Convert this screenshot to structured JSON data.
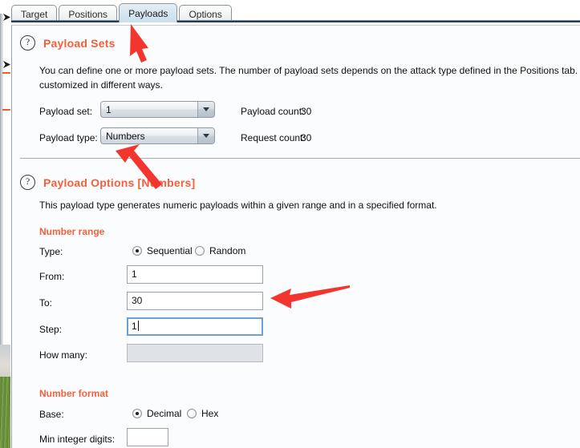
{
  "tabs": [
    {
      "label": "Target",
      "active": false
    },
    {
      "label": "Positions",
      "active": false
    },
    {
      "label": "Payloads",
      "active": true
    },
    {
      "label": "Options",
      "active": false
    }
  ],
  "payload_sets": {
    "help_icon": "question-mark-icon",
    "title": "Payload Sets",
    "description_line1": "You can define one or more payload sets. The number of payload sets depends on the attack type defined in the Positions tab. Various pay",
    "description_line2": "customized in different ways.",
    "payload_set_label": "Payload set:",
    "payload_set_value": "1",
    "payload_type_label": "Payload type:",
    "payload_type_value": "Numbers",
    "payload_count_label": "Payload count:",
    "payload_count_value": "30",
    "request_count_label": "Request count:",
    "request_count_value": "30"
  },
  "payload_options": {
    "help_icon": "question-mark-icon",
    "title": "Payload Options [Numbers]",
    "description": "This payload type generates numeric payloads within a given range and in a specified format.",
    "number_range": {
      "group_title": "Number range",
      "type_label": "Type:",
      "options": [
        {
          "label": "Sequential",
          "checked": true
        },
        {
          "label": "Random",
          "checked": false
        }
      ],
      "from_label": "From:",
      "from_value": "1",
      "to_label": "To:",
      "to_value": "30",
      "step_label": "Step:",
      "step_value": "1",
      "step_focused": true,
      "how_many_label": "How many:",
      "how_many_value": "",
      "how_many_disabled": true
    },
    "number_format": {
      "group_title": "Number format",
      "base_label": "Base:",
      "options": [
        {
          "label": "Decimal",
          "checked": true
        },
        {
          "label": "Hex",
          "checked": false
        }
      ],
      "min_integer_digits_label": "Min integer digits:",
      "min_integer_digits_value": ""
    }
  },
  "annotations": {
    "arrow_color": "#f4352e",
    "arrows": [
      {
        "name": "arrow-to-payloads-tab"
      },
      {
        "name": "arrow-to-payload-type-combo"
      },
      {
        "name": "arrow-to-to-field"
      }
    ]
  },
  "colors": {
    "accent_orange": "#f4603c",
    "tab_active_bg": "#d3e4f0",
    "panel_bg": "#fbfcfd",
    "focus_blue": "#6f9fd0",
    "arrow_red": "#f4352e"
  }
}
